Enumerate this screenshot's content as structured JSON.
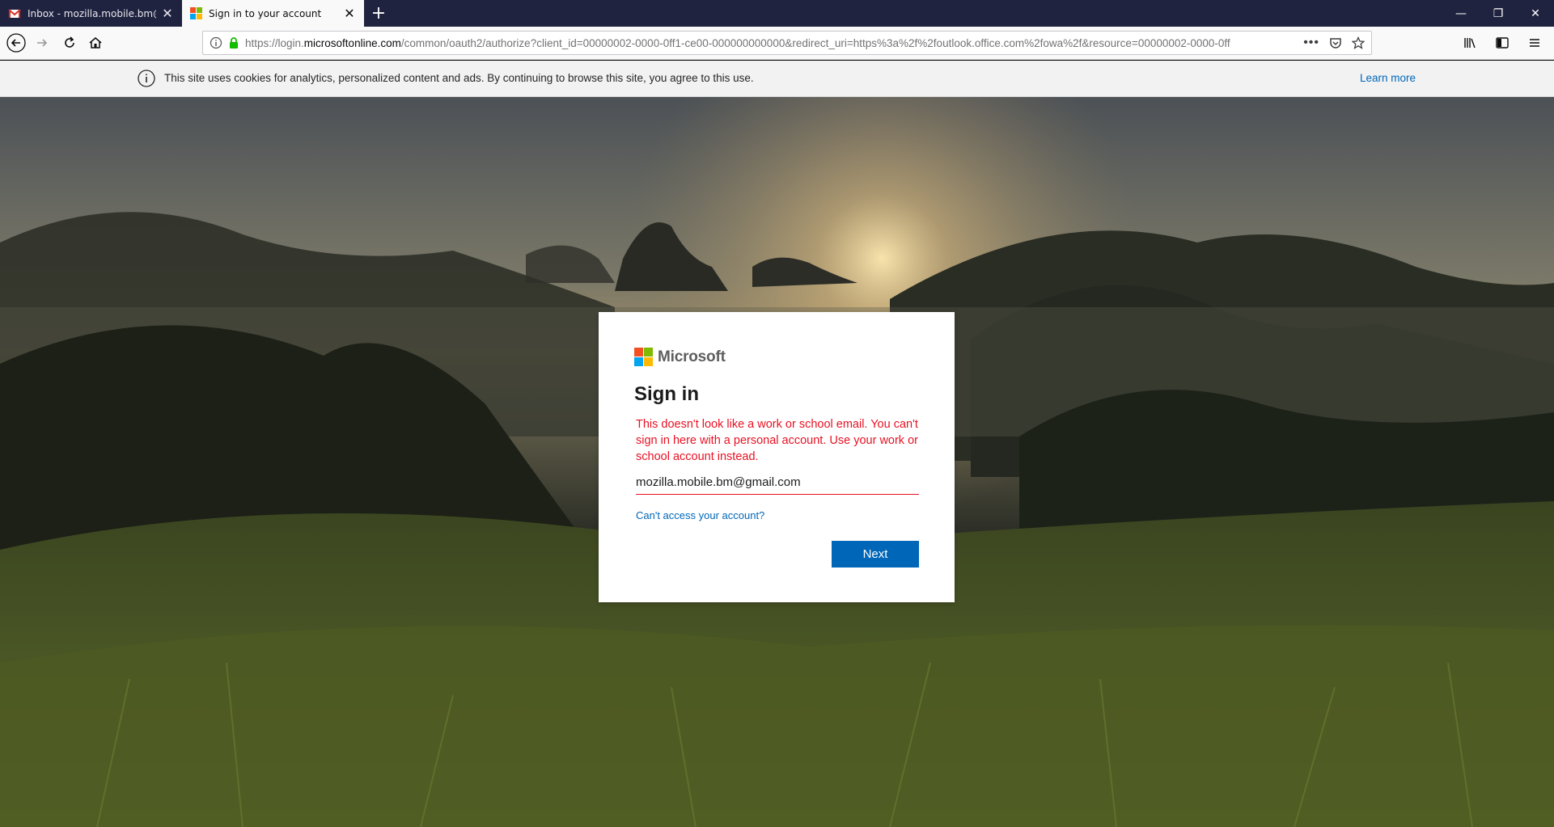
{
  "tabs": [
    {
      "title": "Inbox - mozilla.mobile.bm@gm",
      "active": false,
      "favicon": "gmail-icon"
    },
    {
      "title": "Sign in to your account",
      "active": true,
      "favicon": "microsoft-icon"
    }
  ],
  "window_controls": {
    "minimize": "—",
    "restore": "❐",
    "close": "✕"
  },
  "urlbar": {
    "prefix": "https://login.",
    "domain": "microsoftonline.com",
    "path": "/common/oauth2/authorize?client_id=00000002-0000-0ff1-ce00-000000000000&redirect_uri=https%3a%2f%2foutlook.office.com%2fowa%2f&resource=00000002-0000-0ff"
  },
  "cookie_banner": {
    "text": "This site uses cookies for analytics, personalized content and ads. By continuing to browse this site, you agree to this use.",
    "learn_more": "Learn more"
  },
  "signin": {
    "brand": "Microsoft",
    "heading": "Sign in",
    "error": "This doesn't look like a work or school email. You can't sign in here with a personal account. Use your work or school account instead.",
    "email_value": "mozilla.mobile.bm@gmail.com",
    "cant_access": "Can't access your account?",
    "next_label": "Next"
  },
  "colors": {
    "accent": "#0067b8",
    "error": "#e81123",
    "ms_red": "#f25022",
    "ms_green": "#7fba00",
    "ms_blue": "#00a4ef",
    "ms_yellow": "#ffb900"
  }
}
